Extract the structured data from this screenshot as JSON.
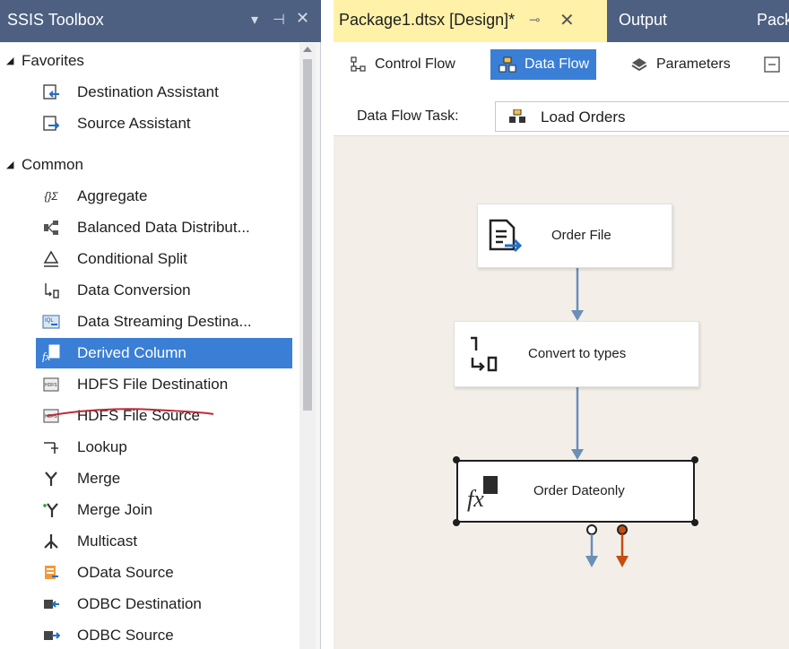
{
  "toolbox": {
    "title": "SSIS Toolbox",
    "categories": [
      {
        "label": "Favorites",
        "items": [
          {
            "label": "Destination Assistant",
            "icon": "destination-assistant-icon"
          },
          {
            "label": "Source Assistant",
            "icon": "source-assistant-icon"
          }
        ]
      },
      {
        "label": "Common",
        "items": [
          {
            "label": "Aggregate",
            "icon": "aggregate-icon"
          },
          {
            "label": "Balanced Data Distribut...",
            "icon": "balanced-distributor-icon"
          },
          {
            "label": "Conditional Split",
            "icon": "conditional-split-icon"
          },
          {
            "label": "Data Conversion",
            "icon": "data-conversion-icon"
          },
          {
            "label": "Data Streaming Destina...",
            "icon": "data-streaming-icon"
          },
          {
            "label": "Derived Column",
            "icon": "derived-column-icon",
            "selected": true
          },
          {
            "label": "HDFS File Destination",
            "icon": "hdfs-destination-icon"
          },
          {
            "label": "HDFS File Source",
            "icon": "hdfs-source-icon"
          },
          {
            "label": "Lookup",
            "icon": "lookup-icon"
          },
          {
            "label": "Merge",
            "icon": "merge-icon"
          },
          {
            "label": "Merge Join",
            "icon": "merge-join-icon"
          },
          {
            "label": "Multicast",
            "icon": "multicast-icon"
          },
          {
            "label": "OData Source",
            "icon": "odata-source-icon"
          },
          {
            "label": "ODBC Destination",
            "icon": "odbc-destination-icon"
          },
          {
            "label": "ODBC Source",
            "icon": "odbc-source-icon"
          }
        ]
      }
    ]
  },
  "tabs": {
    "active": "Package1.dtsx [Design]*",
    "second": "Output",
    "third": "Pack"
  },
  "designer": {
    "tabs": [
      {
        "label": "Control Flow",
        "icon": "control-flow-icon"
      },
      {
        "label": "Data Flow",
        "icon": "data-flow-icon",
        "active": true
      },
      {
        "label": "Parameters",
        "icon": "parameters-icon"
      }
    ],
    "task_label": "Data Flow Task:",
    "task_value": "Load Orders"
  },
  "nodes": [
    {
      "label": "Order File",
      "icon": "flat-file-source-icon"
    },
    {
      "label": "Convert to types",
      "icon": "data-conversion-icon"
    },
    {
      "label": "Order Dateonly",
      "icon": "derived-column-icon",
      "selected": true
    }
  ],
  "colors": {
    "selection": "#3a7fd5",
    "header": "#4d6082",
    "active_tab": "#fff1a8",
    "canvas": "#f3efe8",
    "flow_arrow": "#6a8fb8",
    "error_arrow": "#c44d12",
    "annotation": "#c0283a"
  }
}
